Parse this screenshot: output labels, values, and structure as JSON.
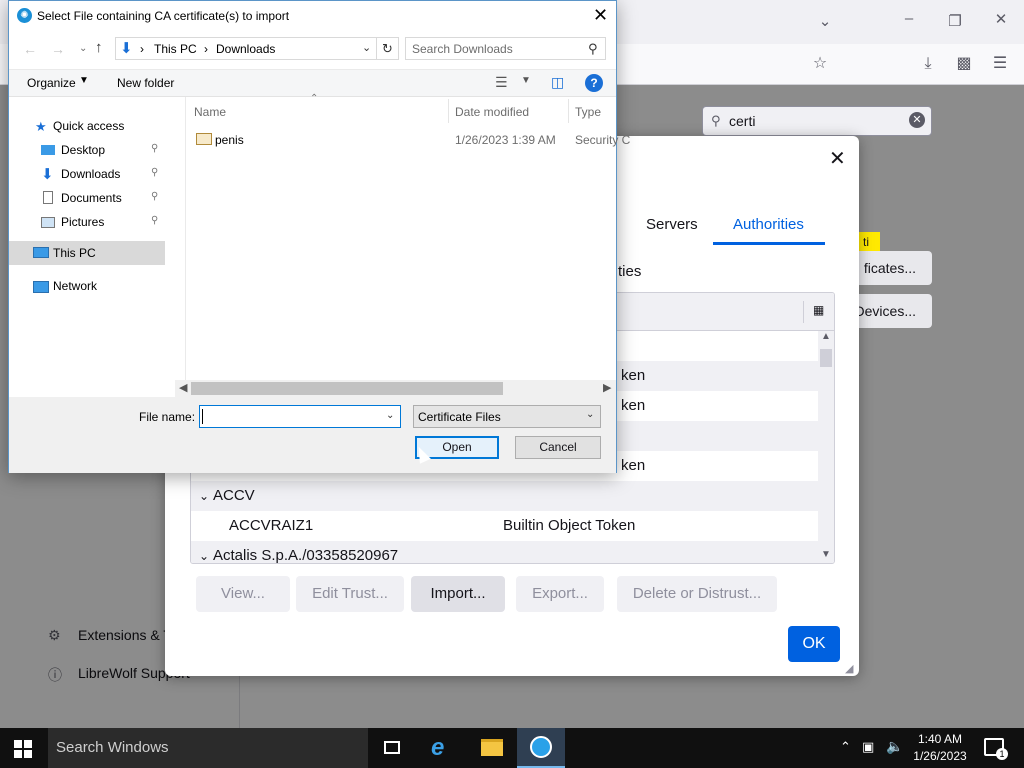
{
  "browser": {
    "search_value": "certi",
    "highlight_tag": "ti",
    "certificates_button": "ficates...",
    "devices_button": "Devices...",
    "sidebar": {
      "extensions_label": "Extensions & T",
      "support_label": "LibreWolf Support"
    }
  },
  "cert_manager": {
    "tabs": [
      "Servers",
      "Authorities"
    ],
    "active_tab": "Authorities",
    "description": "ties",
    "rows": [
      {
        "kind": "partial",
        "name": "",
        "token": ""
      },
      {
        "kind": "partial",
        "name": "",
        "token": "ken"
      },
      {
        "kind": "partial",
        "name": "",
        "token": "ken"
      },
      {
        "kind": "partial",
        "name": "",
        "token": ""
      },
      {
        "kind": "partial",
        "name": "",
        "token": "ken"
      },
      {
        "kind": "group",
        "name": "ACCV",
        "token": ""
      },
      {
        "kind": "item",
        "name": "ACCVRAIZ1",
        "token": "Builtin Object Token"
      },
      {
        "kind": "group",
        "name": "Actalis S.p.A./03358520967",
        "token": ""
      }
    ],
    "buttons": {
      "view": "View...",
      "edit_trust": "Edit Trust...",
      "import": "Import...",
      "export": "Export...",
      "delete": "Delete or Distrust...",
      "ok": "OK"
    }
  },
  "file_dialog": {
    "title": "Select File containing CA certificate(s) to import",
    "breadcrumb": [
      "This PC",
      "Downloads"
    ],
    "search_placeholder": "Search Downloads",
    "toolbar": {
      "organize": "Organize",
      "new_folder": "New folder"
    },
    "nav": {
      "quick_access": "Quick access",
      "items": [
        {
          "label": "Desktop",
          "icon": "desktop-icon"
        },
        {
          "label": "Downloads",
          "icon": "downloads-icon"
        },
        {
          "label": "Documents",
          "icon": "documents-icon"
        },
        {
          "label": "Pictures",
          "icon": "pictures-icon"
        }
      ],
      "this_pc": "This PC",
      "network": "Network"
    },
    "columns": [
      "Name",
      "Date modified",
      "Type"
    ],
    "files": [
      {
        "name": "penis",
        "date": "1/26/2023 1:39 AM",
        "type": "Security C"
      }
    ],
    "file_name_label": "File name:",
    "file_name_value": "",
    "filter": "Certificate Files",
    "open": "Open",
    "cancel": "Cancel"
  },
  "taskbar": {
    "search": "Search Windows",
    "time": "1:40 AM",
    "date": "1/26/2023",
    "notification_count": "1"
  },
  "colors": {
    "accent": "#0061e0",
    "dialog_border": "#0078d7",
    "taskbar": "#101010"
  }
}
